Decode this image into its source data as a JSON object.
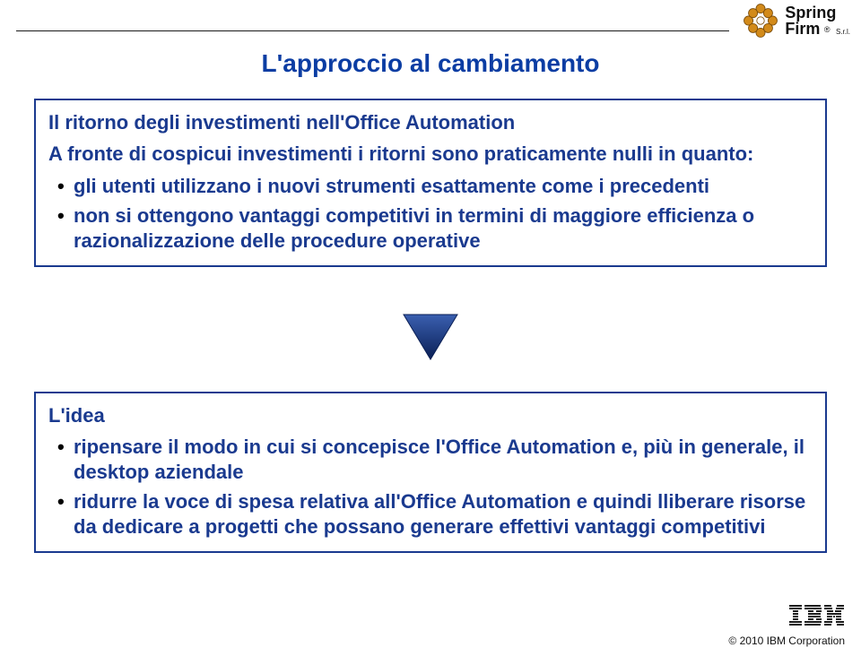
{
  "brand": {
    "name": "Spring",
    "sub": "Firm",
    "srl": "S.r.l.",
    "reg": "®"
  },
  "title": "L'approccio al cambiamento",
  "box1": {
    "heading": "Il ritorno degli investimenti nell'Office Automation",
    "subline": "A fronte di cospicui investimenti i ritorni sono praticamente nulli in quanto:",
    "bullets": [
      "gli utenti utilizzano i nuovi strumenti esattamente come i precedenti",
      "non si ottengono vantaggi competitivi in termini di maggiore efficienza o razionalizzazione delle procedure operative"
    ]
  },
  "box2": {
    "heading": "L'idea",
    "bullets": [
      "ripensare il modo in cui si concepisce l'Office Automation e, più in generale, il desktop aziendale",
      "ridurre la voce di spesa relativa all'Office Automation e quindi lliberare risorse da dedicare a progetti che possano generare effettivi vantaggi competitivi"
    ]
  },
  "footer": {
    "copyright": "© 2010 IBM Corporation"
  }
}
